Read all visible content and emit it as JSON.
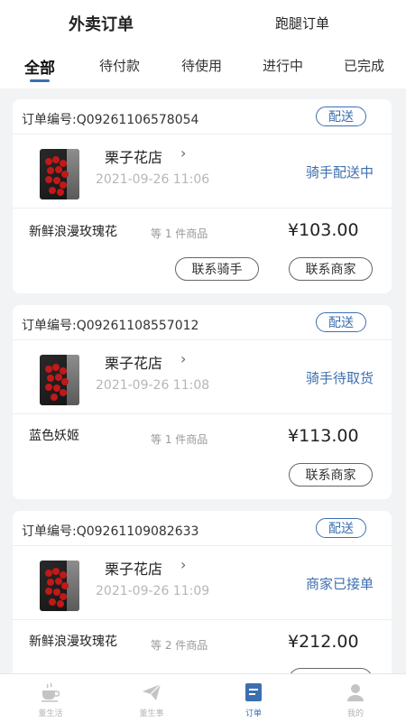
{
  "header": {
    "tabs": [
      {
        "label": "外卖订单",
        "active": true
      },
      {
        "label": "跑腿订单",
        "active": false
      }
    ]
  },
  "filter_tabs": [
    {
      "label": "全部",
      "active": true
    },
    {
      "label": "待付款",
      "active": false
    },
    {
      "label": "待使用",
      "active": false
    },
    {
      "label": "进行中",
      "active": false
    },
    {
      "label": "已完成",
      "active": false
    }
  ],
  "orders": [
    {
      "order_no": "订单编号:Q09261106578054",
      "tag": "配送",
      "shop": "栗子花店",
      "time": "2021-09-26 11:06",
      "status": "骑手配送中",
      "product": "新鲜浪漫玫瑰花",
      "qty": "等 1 件商品",
      "price": "¥103.00",
      "buttons": [
        "联系骑手",
        "联系商家"
      ]
    },
    {
      "order_no": "订单编号:Q09261108557012",
      "tag": "配送",
      "shop": "栗子花店",
      "time": "2021-09-26 11:08",
      "status": "骑手待取货",
      "product": "蓝色妖姬",
      "qty": "等 1 件商品",
      "price": "¥113.00",
      "buttons": [
        "联系商家"
      ]
    },
    {
      "order_no": "订单编号:Q09261109082633",
      "tag": "配送",
      "shop": "栗子花店",
      "time": "2021-09-26 11:09",
      "status": "商家已接单",
      "product": "新鲜浪漫玫瑰花",
      "qty": "等 2 件商品",
      "price": "¥212.00",
      "buttons": []
    }
  ],
  "tabbar": [
    {
      "label": "董生活",
      "icon": "coffee-cup-icon",
      "active": false
    },
    {
      "label": "董生事",
      "icon": "paper-plane-icon",
      "active": false
    },
    {
      "label": "订单",
      "icon": "order-list-icon",
      "active": true
    },
    {
      "label": "我的",
      "icon": "user-icon",
      "active": false
    }
  ],
  "colors": {
    "accent": "#3d6fb0",
    "background": "#f2f3f5"
  }
}
